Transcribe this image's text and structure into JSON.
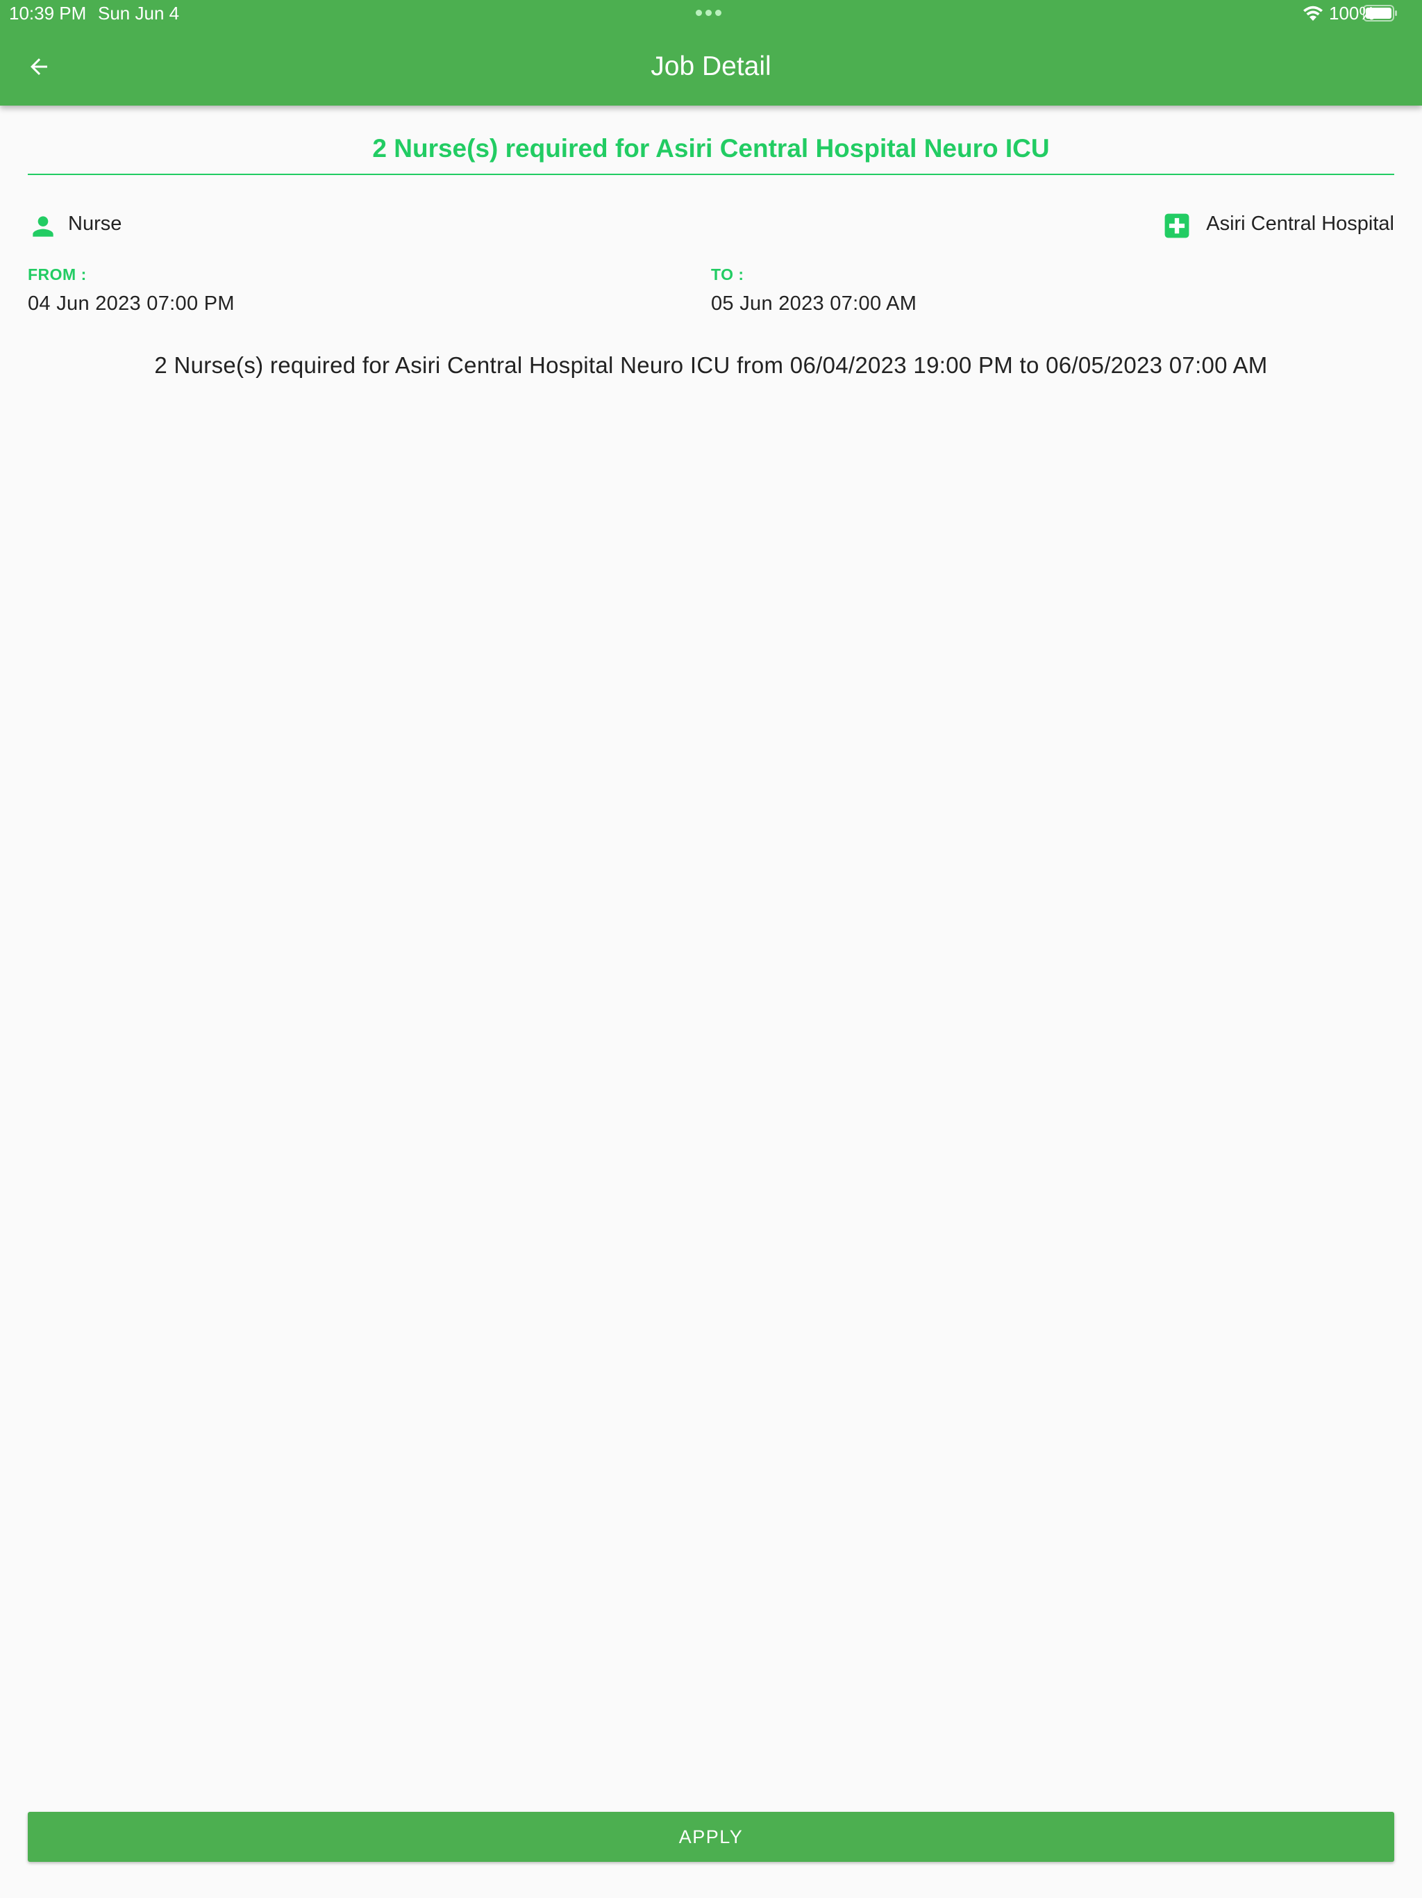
{
  "status_bar": {
    "time": "10:39 PM",
    "date": "Sun Jun 4",
    "battery": "100%",
    "icons": [
      "wifi-icon",
      "battery-icon"
    ]
  },
  "app_bar": {
    "title": "Job Detail",
    "back_icon": "arrow-left-icon"
  },
  "job": {
    "title": "2 Nurse(s) required for Asiri Central Hospital Neuro ICU",
    "role": "Nurse",
    "role_icon": "person-icon",
    "hospital": "Asiri Central Hospital",
    "hospital_icon": "medical-cross-icon",
    "from_label": "FROM :",
    "from_value": "04 Jun 2023 07:00 PM",
    "to_label": "TO :",
    "to_value": "05 Jun 2023 07:00 AM",
    "description": "2 Nurse(s) required for Asiri Central Hospital Neuro ICU from 06/04/2023 19:00 PM to 06/05/2023 07:00 AM"
  },
  "actions": {
    "apply_label": "APPLY"
  },
  "colors": {
    "app_bar": "#4caf50",
    "accent": "#22cc63",
    "background": "#fafafa",
    "text": "#222222"
  }
}
